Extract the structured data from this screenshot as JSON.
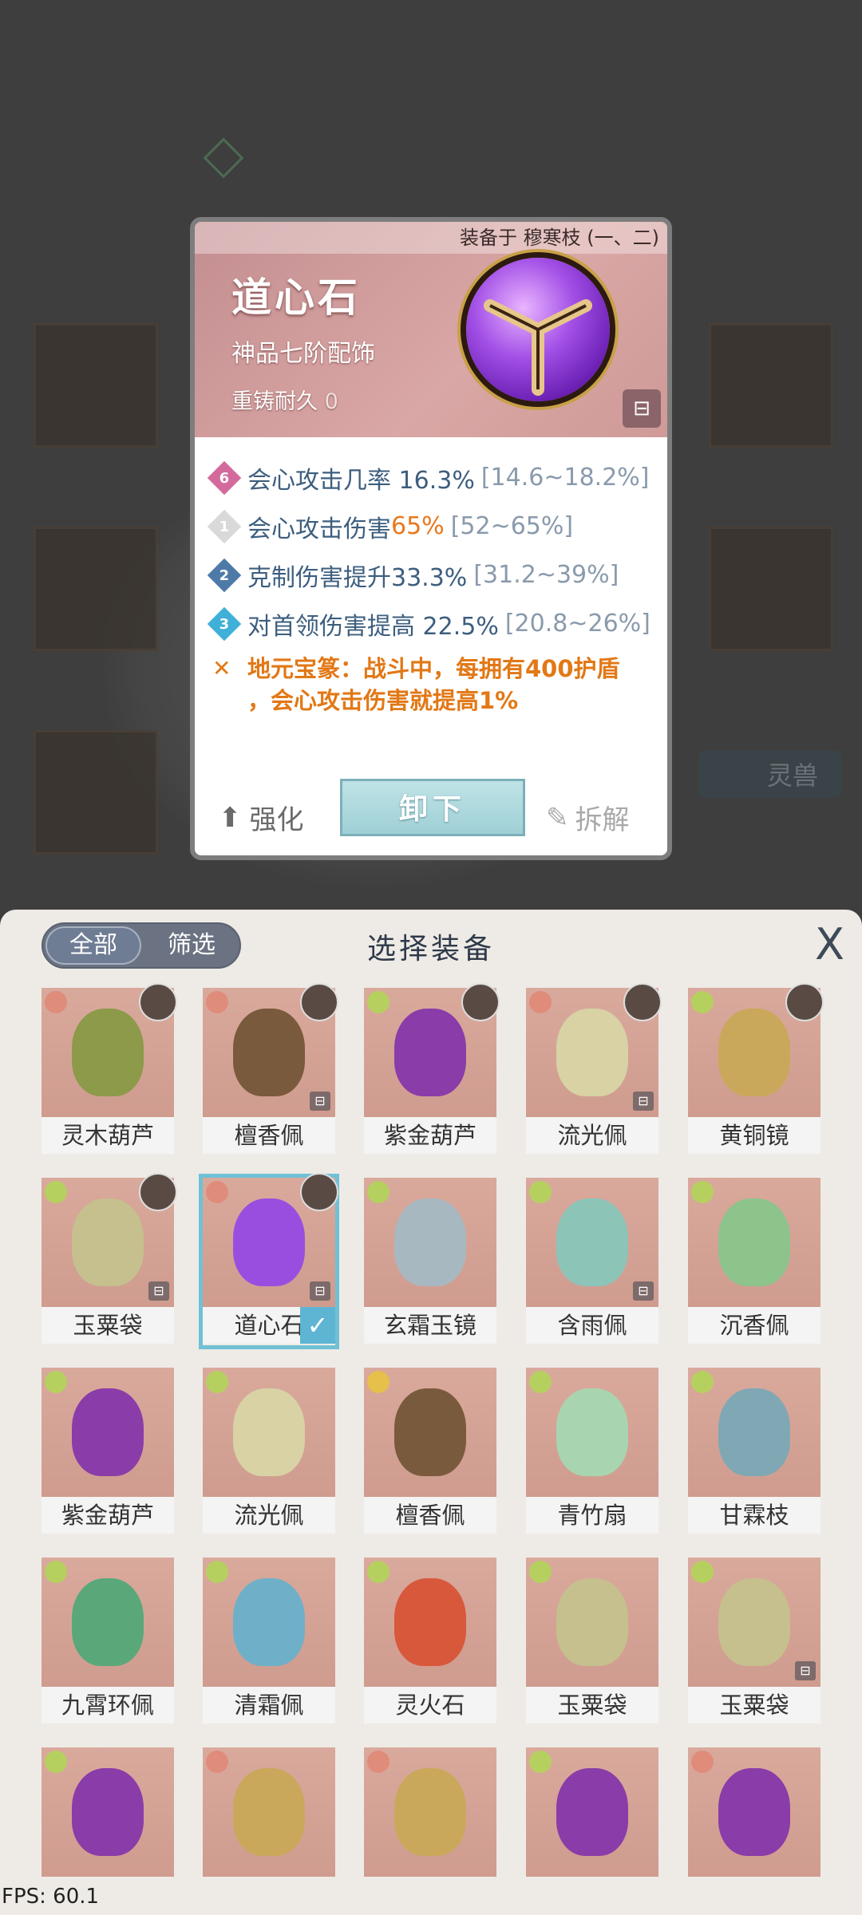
{
  "background": {
    "tab_label": "灵兽"
  },
  "card": {
    "equipped_on": "装备于 穆寒枝 (一、二)",
    "name": "道心石",
    "grade": "神品七阶配饰",
    "durability_label": "重铸耐久",
    "durability_value": "0",
    "stats": [
      {
        "level": "6",
        "text": "会心攻击几率 16.3%",
        "range": "[14.6~18.2%]",
        "badge_color": "#d46a9c"
      },
      {
        "level": "1",
        "text_before": "会心攻击伤害 ",
        "highlight": "65%",
        "range": "[52~65%]",
        "badge_color": "#d9d9d9"
      },
      {
        "level": "2",
        "text": "克制伤害提升33.3%",
        "range": "[31.2~39%]",
        "badge_color": "#4e7aa8"
      },
      {
        "level": "3",
        "text": "对首领伤害提高 22.5%",
        "range": "[20.8~26%]",
        "badge_color": "#3fb0d8"
      }
    ],
    "special_line1": "地元宝篆：战斗中，每拥有400护盾",
    "special_line2": "，会心攻击伤害就提高1%",
    "enhance_label": "强化",
    "unequip_label": "卸下",
    "dismantle_label": "拆解"
  },
  "panel": {
    "filter_all": "全部",
    "filter_screen": "筛选",
    "title": "选择装备",
    "close": "X",
    "items": [
      {
        "name": "灵木葫芦",
        "elem": "r",
        "color": "#8c9a4a",
        "char": true,
        "lock": false,
        "selected": false
      },
      {
        "name": "檀香佩",
        "elem": "r",
        "color": "#7a5a3c",
        "char": true,
        "lock": true,
        "selected": false
      },
      {
        "name": "紫金葫芦",
        "elem": "g",
        "color": "#8a3ca8",
        "char": true,
        "lock": false,
        "selected": false
      },
      {
        "name": "流光佩",
        "elem": "r",
        "color": "#d8d2a4",
        "char": true,
        "lock": true,
        "selected": false
      },
      {
        "name": "黄铜镜",
        "elem": "g",
        "color": "#c9a85c",
        "char": true,
        "lock": false,
        "selected": false
      },
      {
        "name": "玉粟袋",
        "elem": "g",
        "color": "#c6bf8e",
        "char": true,
        "lock": true,
        "selected": false
      },
      {
        "name": "道心石",
        "elem": "r",
        "color": "#9a4ee0",
        "char": true,
        "lock": true,
        "selected": true
      },
      {
        "name": "玄霜玉镜",
        "elem": "g",
        "color": "#a8b8c0",
        "char": false,
        "lock": false,
        "selected": false
      },
      {
        "name": "含雨佩",
        "elem": "g",
        "color": "#8cc4b8",
        "char": false,
        "lock": true,
        "selected": false
      },
      {
        "name": "沉香佩",
        "elem": "g",
        "color": "#8cc48c",
        "char": false,
        "lock": false,
        "selected": false
      },
      {
        "name": "紫金葫芦",
        "elem": "g",
        "color": "#8a3ca8",
        "char": false,
        "lock": false,
        "selected": false
      },
      {
        "name": "流光佩",
        "elem": "g",
        "color": "#d8d2a4",
        "char": false,
        "lock": false,
        "selected": false
      },
      {
        "name": "檀香佩",
        "elem": "y",
        "color": "#7a5a3c",
        "char": false,
        "lock": false,
        "selected": false
      },
      {
        "name": "青竹扇",
        "elem": "g",
        "color": "#a8d4b0",
        "char": false,
        "lock": false,
        "selected": false
      },
      {
        "name": "甘霖枝",
        "elem": "g",
        "color": "#7fa8b4",
        "char": false,
        "lock": false,
        "selected": false
      },
      {
        "name": "九霄环佩",
        "elem": "g",
        "color": "#5aa87a",
        "char": false,
        "lock": false,
        "selected": false
      },
      {
        "name": "清霜佩",
        "elem": "g",
        "color": "#6fb0c8",
        "char": false,
        "lock": false,
        "selected": false
      },
      {
        "name": "灵火石",
        "elem": "g",
        "color": "#d8583c",
        "char": false,
        "lock": false,
        "selected": false
      },
      {
        "name": "玉粟袋",
        "elem": "g",
        "color": "#c6bf8e",
        "char": false,
        "lock": false,
        "selected": false
      },
      {
        "name": "玉粟袋",
        "elem": "g",
        "color": "#c6bf8e",
        "char": false,
        "lock": true,
        "selected": false
      },
      {
        "name": "",
        "elem": "g",
        "color": "#8a3ca8",
        "char": false,
        "lock": false,
        "selected": false
      },
      {
        "name": "",
        "elem": "r",
        "color": "#c9a85c",
        "char": false,
        "lock": false,
        "selected": false
      },
      {
        "name": "",
        "elem": "r",
        "color": "#c9a85c",
        "char": false,
        "lock": false,
        "selected": false
      },
      {
        "name": "",
        "elem": "g",
        "color": "#8a3ca8",
        "char": false,
        "lock": false,
        "selected": false
      },
      {
        "name": "",
        "elem": "r",
        "color": "#8a3ca8",
        "char": false,
        "lock": false,
        "selected": false
      }
    ]
  },
  "fps": "FPS: 60.1"
}
